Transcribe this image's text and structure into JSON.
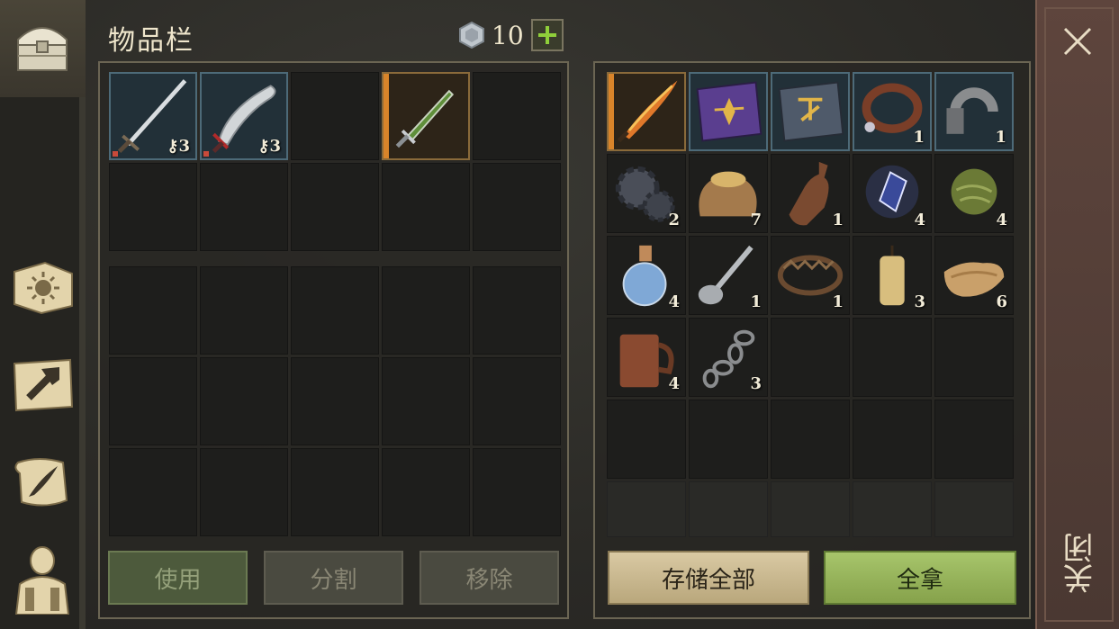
{
  "header": {
    "title": "物品栏",
    "currency_value": "10"
  },
  "inventory": {
    "slots": [
      {
        "name": "sword",
        "count": "3",
        "style": "blue"
      },
      {
        "name": "scimitar",
        "count": "3",
        "style": "blue"
      },
      {
        "name": "empty",
        "count": ""
      },
      {
        "name": "green-dagger",
        "count": "",
        "style": "orange"
      },
      {
        "name": "empty",
        "count": ""
      }
    ]
  },
  "storage": {
    "items": [
      {
        "name": "flaming-sword",
        "count": ""
      },
      {
        "name": "purple-book",
        "count": ""
      },
      {
        "name": "blue-book",
        "count": ""
      },
      {
        "name": "leather-collar",
        "count": "1"
      },
      {
        "name": "iron-shackle",
        "count": "1"
      },
      {
        "name": "gears",
        "count": "2"
      },
      {
        "name": "grain-sack",
        "count": "7"
      },
      {
        "name": "bottle",
        "count": "1"
      },
      {
        "name": "crystal",
        "count": "4"
      },
      {
        "name": "herb-ball",
        "count": "4"
      },
      {
        "name": "potion-flask",
        "count": "4"
      },
      {
        "name": "spoon",
        "count": "1"
      },
      {
        "name": "bear-trap",
        "count": "1"
      },
      {
        "name": "candle",
        "count": "3"
      },
      {
        "name": "cloth",
        "count": "6"
      },
      {
        "name": "tankard",
        "count": "4"
      },
      {
        "name": "chain",
        "count": "3"
      }
    ]
  },
  "buttons": {
    "use": "使用",
    "split": "分割",
    "remove": "移除",
    "store_all": "存储全部",
    "take_all": "全拿"
  },
  "close": {
    "label": "关闭"
  },
  "colors": {
    "accent_green": "#a7c56b",
    "rarity_orange": "#d8842a",
    "rarity_blue": "#4d6a78"
  }
}
